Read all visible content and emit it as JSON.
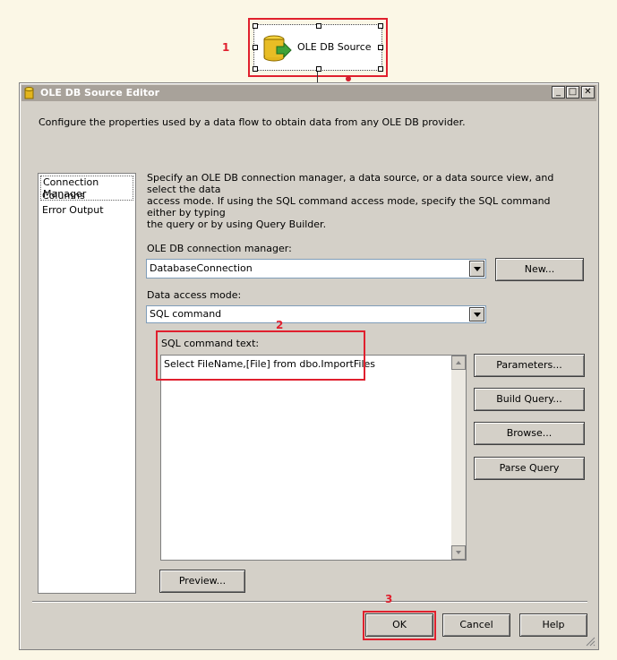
{
  "component": {
    "label": "OLE DB Source"
  },
  "markers": [
    "1",
    "2",
    "3"
  ],
  "dialog": {
    "title": "OLE DB Source Editor",
    "description": "Configure the properties used by a data flow to obtain data from any OLE DB provider.",
    "nav": [
      "Connection Manager",
      "Columns",
      "Error Output"
    ],
    "help_lines": [
      "Specify an OLE DB connection manager, a data source, or a data source view, and select the data",
      "access mode. If using the SQL command access mode, specify the SQL command either by typing",
      "the query or by using Query Builder."
    ],
    "conn_label": "OLE DB connection manager:",
    "conn_value": "DatabaseConnection",
    "new_button": "New...",
    "mode_label": "Data access mode:",
    "mode_value": "SQL command",
    "sql_label": "SQL command text:",
    "sql_text": "Select  FileName,[File] from dbo.ImportFiles",
    "side_buttons": [
      "Parameters...",
      "Build Query...",
      "Browse...",
      "Parse Query"
    ],
    "preview_button": "Preview...",
    "ok_button": "OK",
    "cancel_button": "Cancel",
    "help_button": "Help"
  }
}
